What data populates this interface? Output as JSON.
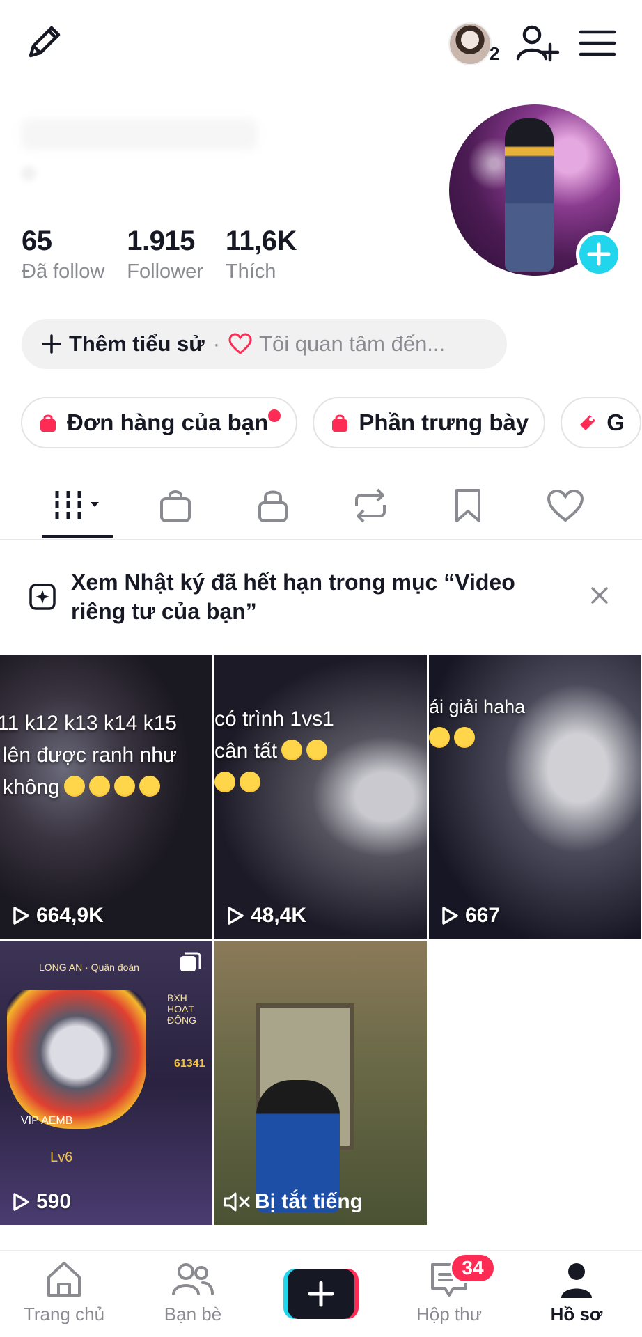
{
  "header": {
    "friends_count": "2"
  },
  "stats": [
    {
      "value": "65",
      "label": "Đã follow"
    },
    {
      "value": "1.915",
      "label": "Follower"
    },
    {
      "value": "11,6K",
      "label": "Thích"
    }
  ],
  "bio": {
    "add_label": "Thêm tiểu sử",
    "separator": "·",
    "interest_label": "Tôi quan tâm đến..."
  },
  "chips": [
    {
      "label": "Đơn hàng của bạn",
      "has_dot": true
    },
    {
      "label": "Phần trưng bày",
      "has_dot": false
    },
    {
      "label": "G",
      "has_dot": false
    }
  ],
  "tabs": [
    "videos",
    "shop",
    "private",
    "reposts",
    "saved",
    "liked"
  ],
  "banner": {
    "text": "Xem Nhật ký đã hết hạn trong mục “Video riêng tư của bạn”"
  },
  "videos": [
    {
      "views": "664,9K",
      "caption": [
        "11 k12 k13 k14 k15",
        "lên được ranh như",
        "không"
      ]
    },
    {
      "views": "48,4K",
      "caption": [
        "có trình 1vs1",
        "cân tất",
        ""
      ]
    },
    {
      "views": "667",
      "caption": [
        "ái giải haha",
        ""
      ]
    },
    {
      "views": "590",
      "hud": {
        "clan": "LONG AN · Quân đoàn",
        "vip": "VIP  AEMB",
        "level": "Lv6",
        "score": "61341",
        "rank": "BXH HOẠT ĐỘNG"
      }
    },
    {
      "status": "Bị tắt tiếng"
    }
  ],
  "bottom_nav": {
    "home": "Trang chủ",
    "friends": "Bạn bè",
    "inbox": "Hộp thư",
    "inbox_badge": "34",
    "profile": "Hồ sơ"
  },
  "colors": {
    "accent_red": "#fe2c55",
    "accent_cyan": "#20d5ec",
    "text_primary": "#161823",
    "text_secondary": "#8a8b91"
  }
}
